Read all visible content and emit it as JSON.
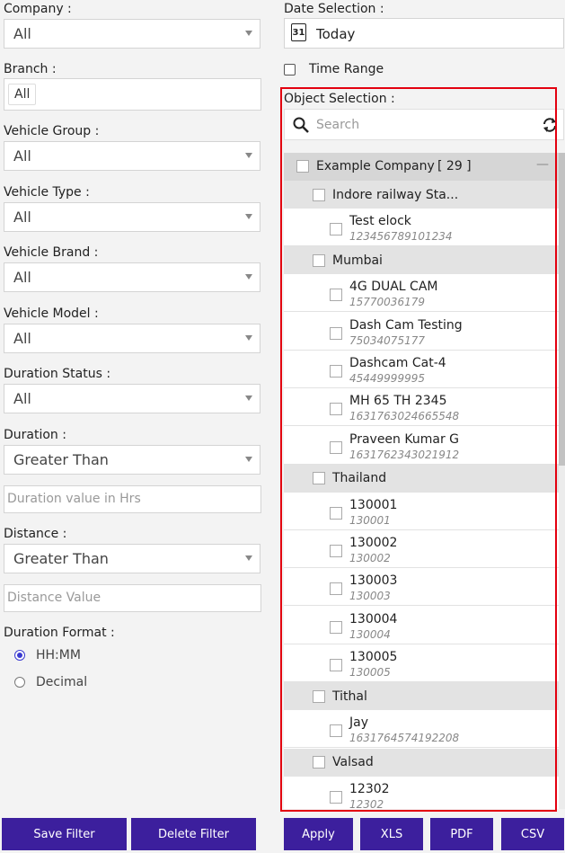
{
  "filters": {
    "company": {
      "label": "Company :",
      "value": "All"
    },
    "branch": {
      "label": "Branch :",
      "value": "All"
    },
    "vehicle_group": {
      "label": "Vehicle Group :",
      "value": "All"
    },
    "vehicle_type": {
      "label": "Vehicle Type :",
      "value": "All"
    },
    "vehicle_brand": {
      "label": "Vehicle Brand :",
      "value": "All"
    },
    "vehicle_model": {
      "label": "Vehicle Model :",
      "value": "All"
    },
    "duration_status": {
      "label": "Duration Status :",
      "value": "All"
    },
    "duration": {
      "label": "Duration :",
      "value": "Greater Than",
      "placeholder": "Duration value in Hrs"
    },
    "distance": {
      "label": "Distance :",
      "value": "Greater Than",
      "placeholder": "Distance Value"
    },
    "duration_format": {
      "label": "Duration Format :",
      "options": [
        {
          "label": "HH:MM",
          "selected": true
        },
        {
          "label": "Decimal",
          "selected": false
        }
      ]
    }
  },
  "date_selection": {
    "label": "Date Selection :",
    "value": "Today",
    "calendar_day": "31",
    "time_range_label": "Time Range",
    "time_range_checked": false
  },
  "object_selection": {
    "label": "Object Selection :",
    "search_placeholder": "Search",
    "company_name": "Example Company",
    "count": "[ 29 ]",
    "collapse_symbol": "—",
    "items": [
      {
        "kind": "group",
        "name": "Indore railway Sta..."
      },
      {
        "kind": "vehicle",
        "name": "Test elock",
        "sub": "123456789101234"
      },
      {
        "kind": "group",
        "name": "Mumbai"
      },
      {
        "kind": "vehicle",
        "name": "4G DUAL CAM",
        "sub": "15770036179"
      },
      {
        "kind": "vehicle",
        "name": "Dash Cam Testing",
        "sub": "75034075177"
      },
      {
        "kind": "vehicle",
        "name": "Dashcam Cat-4",
        "sub": "45449999995"
      },
      {
        "kind": "vehicle",
        "name": "MH 65 TH 2345",
        "sub": "1631763024665548"
      },
      {
        "kind": "vehicle",
        "name": "Praveen Kumar G",
        "sub": "1631762343021912"
      },
      {
        "kind": "group",
        "name": "Thailand"
      },
      {
        "kind": "vehicle",
        "name": "130001",
        "sub": "130001"
      },
      {
        "kind": "vehicle",
        "name": "130002",
        "sub": "130002"
      },
      {
        "kind": "vehicle",
        "name": "130003",
        "sub": "130003"
      },
      {
        "kind": "vehicle",
        "name": "130004",
        "sub": "130004"
      },
      {
        "kind": "vehicle",
        "name": "130005",
        "sub": "130005"
      },
      {
        "kind": "group",
        "name": "Tithal"
      },
      {
        "kind": "vehicle",
        "name": "Jay",
        "sub": "1631764574192208"
      },
      {
        "kind": "group",
        "name": "Valsad"
      },
      {
        "kind": "vehicle",
        "name": "12302",
        "sub": "12302"
      }
    ]
  },
  "buttons": {
    "save_filter": "Save Filter",
    "delete_filter": "Delete Filter",
    "apply": "Apply",
    "xls": "XLS",
    "pdf": "PDF",
    "csv": "CSV"
  },
  "colors": {
    "button_bg": "#3c1f9d",
    "highlight_border": "#e3000f",
    "radio_accent": "#3a3ad0"
  }
}
